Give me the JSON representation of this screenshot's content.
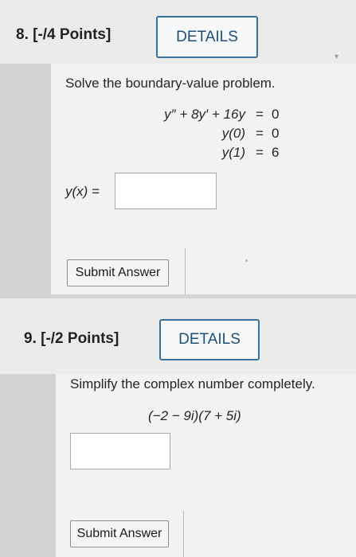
{
  "q8": {
    "title": "8. [-/4 Points]",
    "details": "DETAILS",
    "prompt": "Solve the boundary-value problem.",
    "equations": [
      {
        "left": "y″ + 8y′ + 16y",
        "op": "=",
        "right": "0"
      },
      {
        "left": "y(0)",
        "op": "=",
        "right": "0"
      },
      {
        "left": "y(1)",
        "op": "=",
        "right": "6"
      }
    ],
    "answer_label": "y(x) =",
    "submit": "Submit Answer"
  },
  "q9": {
    "title": "9. [-/2 Points]",
    "details": "DETAILS",
    "prompt": "Simplify the complex number completely.",
    "expression": "(−2 − 9i)(7 + 5i)",
    "submit": "Submit Answer"
  },
  "icons": {
    "collapse": "chevron-down-icon"
  }
}
